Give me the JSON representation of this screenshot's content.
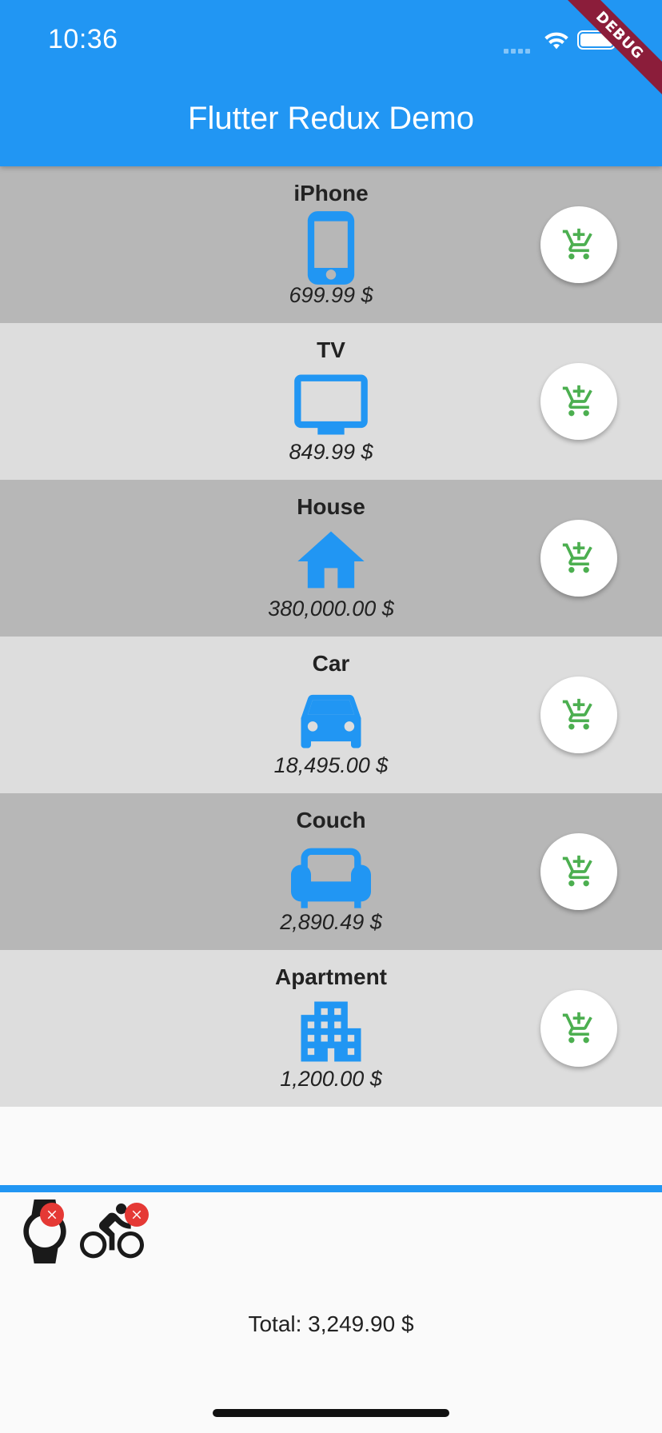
{
  "status_bar": {
    "time": "10:36"
  },
  "debug_banner": "DEBUG",
  "app_bar": {
    "title": "Flutter Redux Demo"
  },
  "colors": {
    "primary": "#2196f3",
    "cart_add": "#4caf50",
    "remove_badge": "#e53935",
    "row_dark": "#b7b7b7",
    "row_light": "#dddddd"
  },
  "products": [
    {
      "name": "iPhone",
      "price": "699.99 $",
      "icon": "phone-icon"
    },
    {
      "name": "TV",
      "price": "849.99 $",
      "icon": "tv-icon"
    },
    {
      "name": "House",
      "price": "380,000.00 $",
      "icon": "house-icon"
    },
    {
      "name": "Car",
      "price": "18,495.00 $",
      "icon": "car-icon"
    },
    {
      "name": "Couch",
      "price": "2,890.49 $",
      "icon": "couch-icon"
    },
    {
      "name": "Apartment",
      "price": "1,200.00 $",
      "icon": "apartment-icon"
    }
  ],
  "cart": {
    "items": [
      {
        "icon": "watch-icon"
      },
      {
        "icon": "bike-icon"
      }
    ],
    "total": "Total: 3,249.90 $"
  }
}
